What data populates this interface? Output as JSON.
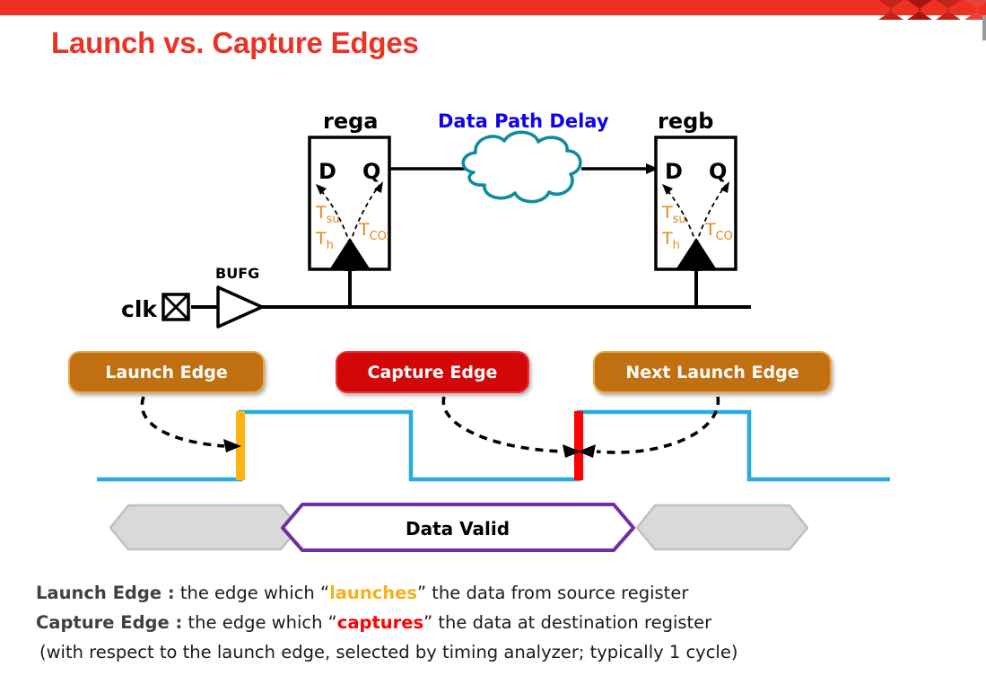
{
  "slide": {
    "title": "Launch vs. Capture Edges",
    "accent_color": "#EE3124",
    "band_color": "#EE3124"
  },
  "diagram": {
    "clock_pin_label": "clk",
    "buffer_label": "BUFG",
    "data_path_label": "Data Path Delay",
    "data_path_color": "#1100EE",
    "cloud_color": "#0E8C9E",
    "registers": [
      {
        "name": "rega",
        "pin_d": "D",
        "pin_q": "Q",
        "t_su": "T",
        "t_su_sub": "su",
        "t_h": "T",
        "t_h_sub": "h",
        "t_co": "T",
        "t_co_sub": "CO"
      },
      {
        "name": "regb",
        "pin_d": "D",
        "pin_q": "Q",
        "t_su": "T",
        "t_su_sub": "su",
        "t_h": "T",
        "t_h_sub": "h",
        "t_co": "T",
        "t_co_sub": "CO"
      }
    ]
  },
  "waveform": {
    "clock_color": "#29ABE2",
    "launch_marker_color": "#FFB511",
    "capture_marker_color": "#FF0000",
    "data_valid_label": "Data Valid",
    "data_valid_border": "#7030A0",
    "idle_fill": "#D9D9D9",
    "idle_border": "#BFBFBF"
  },
  "edge_labels": {
    "launch": "Launch Edge",
    "capture": "Capture  Edge",
    "next_launch": "Next Launch Edge",
    "launch_bg": "#C07010",
    "capture_bg": "#D30707"
  },
  "body_text": {
    "line1_lead": "Launch Edge :",
    "line1_a": "  the edge which “",
    "line1_hl": "launches",
    "line1_b": "” the data from source register",
    "line2_lead": "Capture Edge :",
    "line2_a": " the edge which “",
    "line2_hl": "captures",
    "line2_b": "” the data at destination register",
    "line3": " (with respect to the launch edge, selected by timing analyzer; typically 1 cycle)"
  }
}
